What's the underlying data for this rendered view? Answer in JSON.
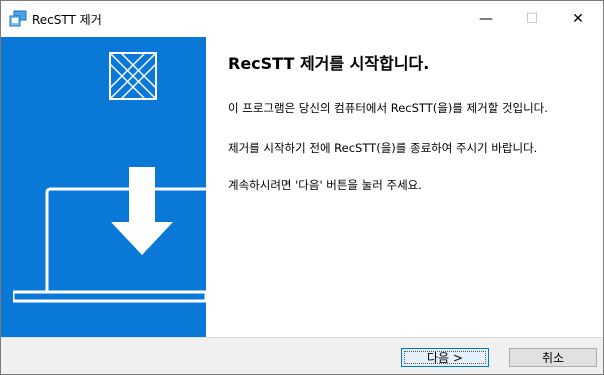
{
  "window": {
    "title": "RecSTT 제거",
    "controls": {
      "minimize": "—",
      "maximize": "☐",
      "close": "✕"
    }
  },
  "content": {
    "heading": "RecSTT 제거를 시작합니다.",
    "paragraphs": [
      "이 프로그램은 당신의 컴퓨터에서 RecSTT(을)를 제거할 것입니다.",
      "제거를 시작하기 전에 RecSTT(을)를 종료하여 주시기 바랍니다.",
      "계속하시려면 '다음' 버튼을 눌러 주세요."
    ]
  },
  "footer": {
    "next_label": "다음 >",
    "cancel_label": "취소"
  },
  "icons": {
    "app": "installer-app-icon",
    "logo": "envelope-pattern-logo",
    "illustration": "laptop-download-icon"
  },
  "colors": {
    "side_panel": "#0a78d7",
    "footer": "#f0f0f0",
    "next_button_border": "#0078d7"
  }
}
